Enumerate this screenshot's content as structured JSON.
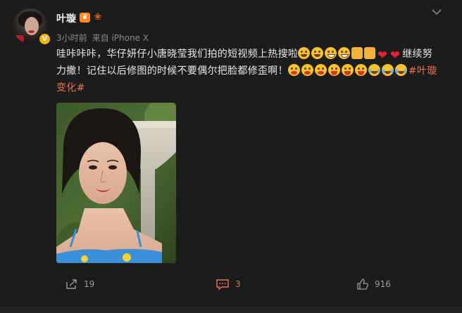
{
  "post": {
    "author": {
      "name": "叶璇",
      "verified_icon": "verified-v-icon",
      "badges": [
        "crown-badge-icon",
        "flower-badge-icon"
      ]
    },
    "meta": {
      "time": "3小时前",
      "source": "来自 iPhone X"
    },
    "menu_icon": "chevron-down-icon",
    "content": {
      "line1_text": "哇咔咔咔，华仔妍仔小唐晓莹我们拍的短视频上热搜啦",
      "line1_tail": "继续努",
      "line2_text": "力撒！记住以后修图的时候不要偶尔把脸都修歪啊！",
      "hashtag_part1": "#叶璇",
      "hashtag_part2": "变化#",
      "emojis_line1": [
        "smile",
        "smile",
        "grin",
        "grin",
        "beer",
        "beer",
        "heart",
        "heart"
      ],
      "emojis_line2": [
        "cry",
        "cry",
        "cry",
        "laugh",
        "laugh",
        "laugh",
        "tear",
        "tear",
        "tear"
      ]
    },
    "photo": {
      "description_icon": "selfie-photo"
    },
    "actions": {
      "share_count": "19",
      "comment_count": "3",
      "like_count": "916"
    },
    "colors": {
      "background": "#1c1c1c",
      "text": "#e8e8e8",
      "meta": "#8a8a8a",
      "hashtag": "#eb7350",
      "active_action": "#eb7350"
    }
  }
}
